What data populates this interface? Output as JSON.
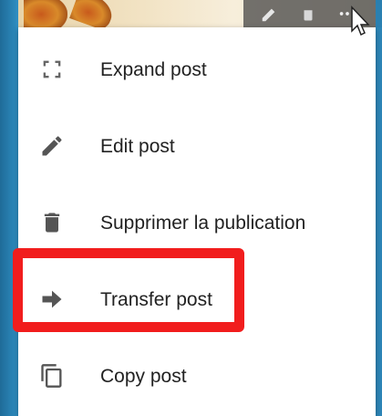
{
  "toolbar": {
    "icons": [
      "pencil-icon",
      "trash-icon",
      "more-icon"
    ]
  },
  "menu": {
    "items": [
      {
        "label": "Expand post",
        "icon": "expand-icon"
      },
      {
        "label": "Edit post",
        "icon": "pencil-icon"
      },
      {
        "label": "Supprimer la publication",
        "icon": "trash-icon"
      },
      {
        "label": "Transfer post",
        "icon": "arrow-right-icon"
      },
      {
        "label": "Copy post",
        "icon": "copy-icon"
      }
    ],
    "highlighted_index": 3
  },
  "colors": {
    "background": "#2e8cc0",
    "menu_bg": "#ffffff",
    "icon": "#555555",
    "text": "#222222",
    "highlight_border": "#f11d1d"
  }
}
